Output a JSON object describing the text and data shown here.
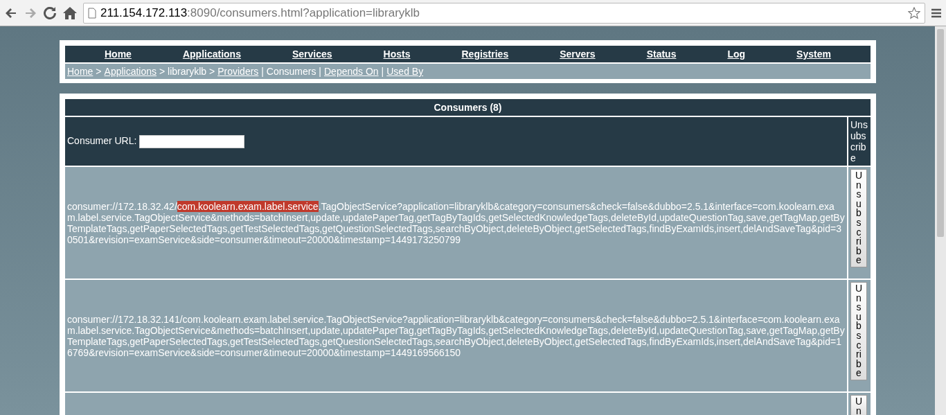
{
  "browser": {
    "url_host": "211.154.172.113",
    "url_rest": ":8090/consumers.html?application=libraryklb"
  },
  "nav": {
    "items": [
      "Home",
      "Applications",
      "Services",
      "Hosts",
      "Registries",
      "Servers",
      "Status",
      "Log",
      "System"
    ]
  },
  "breadcrumb": [
    {
      "kind": "link",
      "text": "Home"
    },
    {
      "kind": "text",
      "text": ">"
    },
    {
      "kind": "link",
      "text": "Applications"
    },
    {
      "kind": "text",
      "text": "> libraryklb >"
    },
    {
      "kind": "link",
      "text": "Providers"
    },
    {
      "kind": "text",
      "text": "| Consumers |"
    },
    {
      "kind": "link",
      "text": "Depends On"
    },
    {
      "kind": "text",
      "text": "|"
    },
    {
      "kind": "link",
      "text": "Used By"
    }
  ],
  "table": {
    "title": "Consumers (8)",
    "filter_label": "Consumer URL:",
    "action_header": "Unsubscribe",
    "rows": [
      {
        "url": [
          {
            "text": "consumer://172.18.32.42/",
            "highlighted": false
          },
          {
            "text": "com.koolearn.exam.label.service",
            "highlighted": true
          },
          {
            "text": ".TagObjectService?application=libraryklb&category=consumers&check=false&dubbo=2.5.1&interface=com.koolearn.exam.label.service.TagObjectService&methods=batchInsert,update,updatePaperTag,getTagByTagIds,getSelectedKnowledgeTags,deleteById,updateQuestionTag,save,getTagMap,getByTemplateTags,getPaperSelectedTags,getTestSelectedTags,getQuestionSelectedTags,searchByObject,deleteByObject,getSelectedTags,findByExamIds,insert,delAndSaveTag&pid=30501&revision=examService&side=consumer&timeout=20000&timestamp=1449173250799",
            "highlighted": false
          }
        ],
        "button": "Unsubscribe"
      },
      {
        "url": [
          {
            "text": "consumer://172.18.32.141/com.koolearn.exam.label.service.TagObjectService?application=libraryklb&category=consumers&check=false&dubbo=2.5.1&interface=com.koolearn.exam.label.service.TagObjectService&methods=batchInsert,update,updatePaperTag,getTagByTagIds,getSelectedKnowledgeTags,deleteById,updateQuestionTag,save,getTagMap,getByTemplateTags,getPaperSelectedTags,getTestSelectedTags,getQuestionSelectedTags,searchByObject,deleteByObject,getSelectedTags,findByExamIds,insert,delAndSaveTag&pid=16769&revision=examService&side=consumer&timeout=20000&timestamp=1449169566150",
            "highlighted": false
          }
        ],
        "button": "Unsubscribe"
      },
      {
        "url": [],
        "button": "Un"
      }
    ]
  }
}
